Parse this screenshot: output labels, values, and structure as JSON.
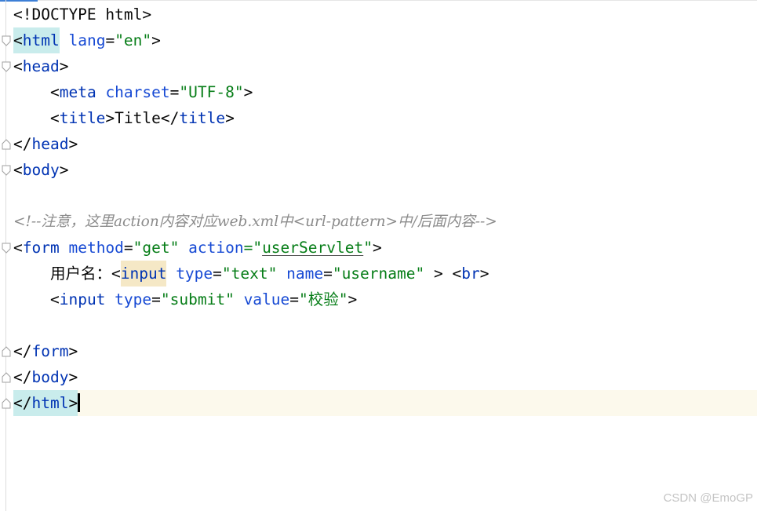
{
  "editor": {
    "lines": {
      "doctype": "<!DOCTYPE html>",
      "html_open_lt": "<",
      "html_open_tag": "html",
      "html_open_attr": "lang",
      "html_open_eq": "=",
      "html_open_val": "\"en\"",
      "html_open_gt": ">",
      "head_open_lt": "<",
      "head_open_tag": "head",
      "head_open_gt": ">",
      "meta_lt": "<",
      "meta_tag": "meta",
      "meta_attr": "charset",
      "meta_eq": "=",
      "meta_val": "\"UTF-8\"",
      "meta_gt": ">",
      "title_open_lt": "<",
      "title_open_tag": "title",
      "title_open_gt": ">",
      "title_text": "Title",
      "title_close_lt": "</",
      "title_close_tag": "title",
      "title_close_gt": ">",
      "head_close_lt": "</",
      "head_close_tag": "head",
      "head_close_gt": ">",
      "body_open_lt": "<",
      "body_open_tag": "body",
      "body_open_gt": ">",
      "comment": "<!--注意，这里action内容对应web.xml中<url-pattern>中/后面内容-->",
      "form_lt": "<",
      "form_tag": "form",
      "form_attr1": "method",
      "form_eq1": "=",
      "form_val1": "\"get\"",
      "form_attr2": "action",
      "form_eq2": "=\"",
      "form_val2": "userServlet",
      "form_q2": "\"",
      "form_gt": ">",
      "label_text": "用户名：",
      "input1_lt": "<",
      "input1_tag": "input",
      "input1_attr1": "type",
      "input1_eq1": "=",
      "input1_val1": "\"text\"",
      "input1_attr2": "name",
      "input1_eq2": "=",
      "input1_val2": "\"username\"",
      "input1_gt": " > ",
      "br_lt": "<",
      "br_tag": "br",
      "br_gt": ">",
      "input2_lt": "<",
      "input2_tag": "input",
      "input2_attr1": "type",
      "input2_eq1": "=",
      "input2_val1": "\"submit\"",
      "input2_attr2": "value",
      "input2_eq2": "=",
      "input2_val2": "\"校验\"",
      "input2_gt": ">",
      "form_close_lt": "</",
      "form_close_tag": "form",
      "form_close_gt": ">",
      "body_close_lt": "</",
      "body_close_tag": "body",
      "body_close_gt": ">",
      "html_close_lt": "</",
      "html_close_tag": "html",
      "html_close_gt": ">"
    },
    "colors": {
      "tag": "#0033b3",
      "attribute": "#174ad4",
      "value": "#067d17",
      "comment": "#8c8c8c",
      "current_line": "#fcf9ec",
      "brace_match": "#c9ecec"
    }
  },
  "watermark": {
    "text": "CSDN @EmoGP"
  }
}
